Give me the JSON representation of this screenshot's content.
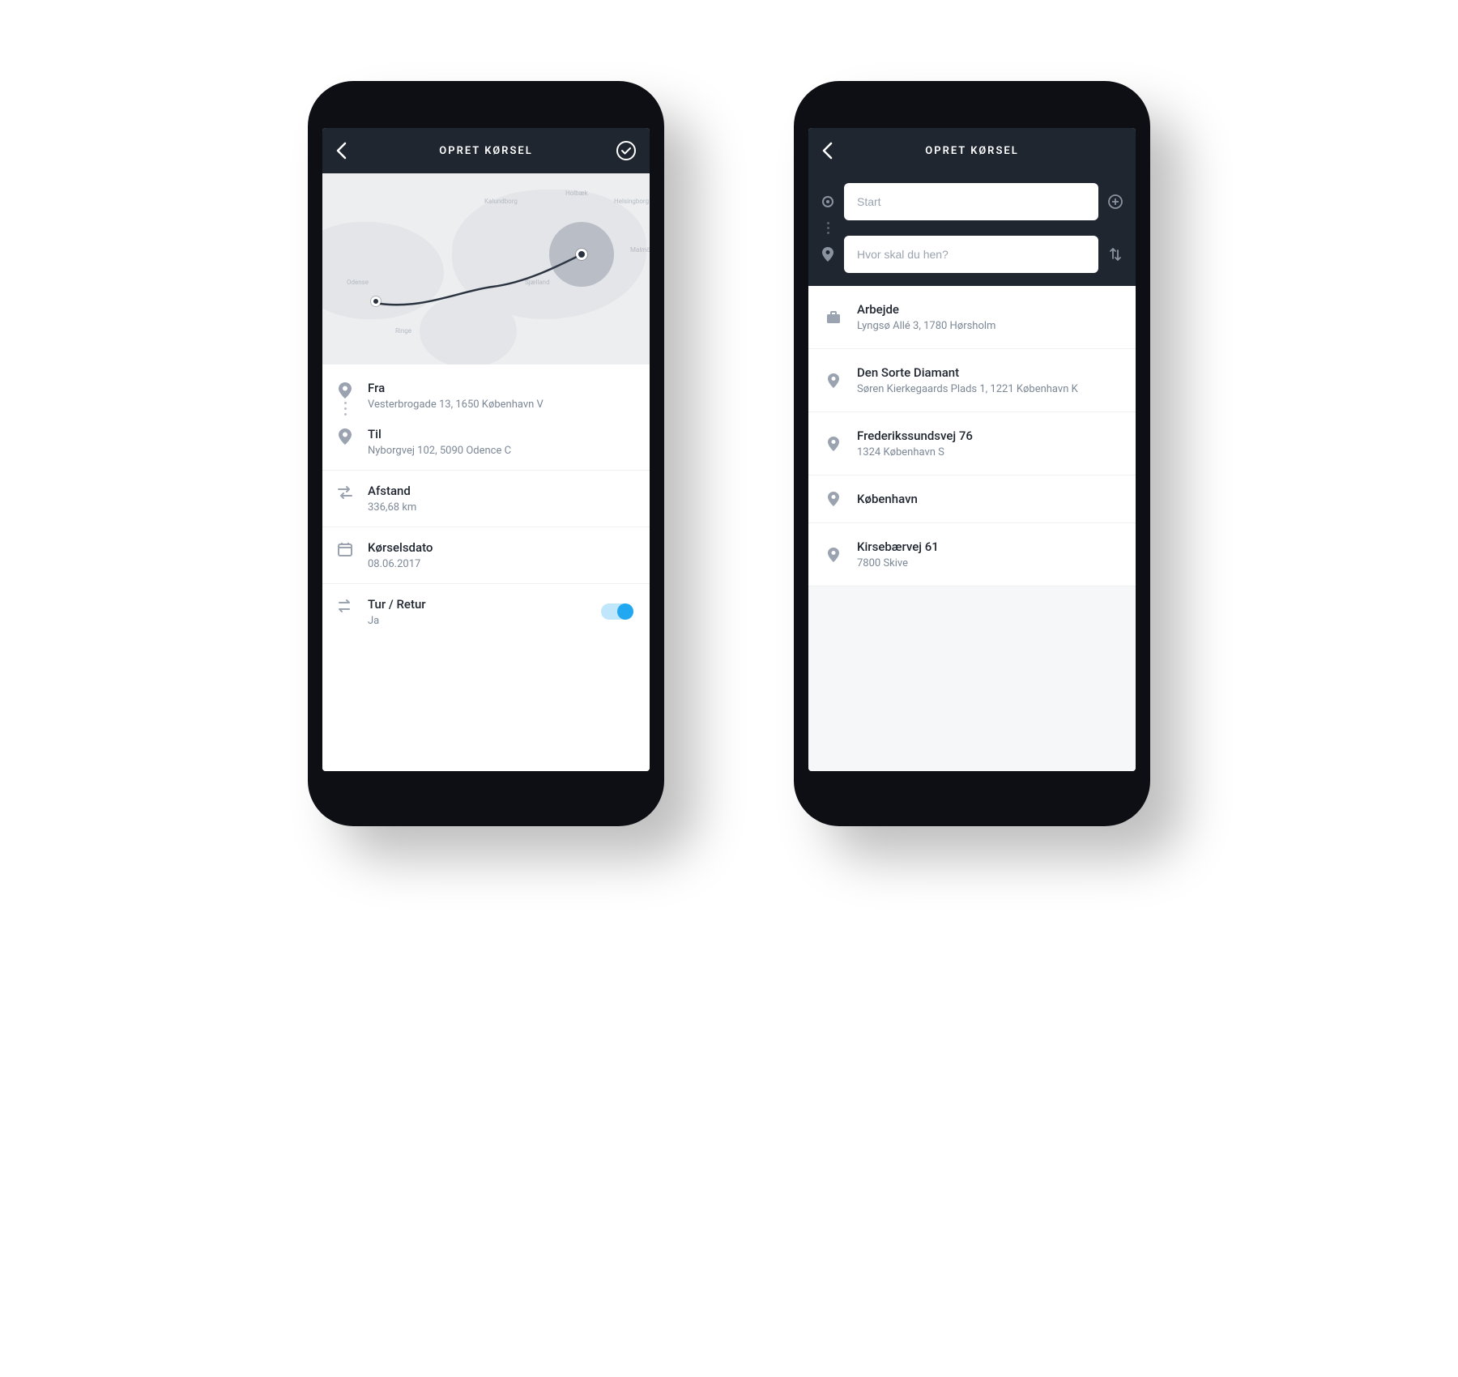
{
  "phone1": {
    "header": {
      "title": "OPRET KØRSEL"
    },
    "from": {
      "label": "Fra",
      "address": "Vesterbrogade 13, 1650 København V"
    },
    "to": {
      "label": "Til",
      "address": "Nyborgvej 102, 5090 Odence C"
    },
    "distance": {
      "label": "Afstand",
      "value": "336,68 km"
    },
    "date": {
      "label": "Kørselsdato",
      "value": "08.06.2017"
    },
    "roundtrip": {
      "label": "Tur / Retur",
      "value": "Ja",
      "on": true
    }
  },
  "phone2": {
    "header": {
      "title": "OPRET KØRSEL"
    },
    "inputs": {
      "start_placeholder": "Start",
      "dest_placeholder": "Hvor skal du hen?"
    },
    "suggestions": [
      {
        "icon": "briefcase",
        "title": "Arbejde",
        "subtitle": "Lyngsø Allé 3, 1780 Hørsholm"
      },
      {
        "icon": "pin",
        "title": "Den Sorte Diamant",
        "subtitle": "Søren Kierkegaards Plads 1, 1221 København K"
      },
      {
        "icon": "pin",
        "title": "Frederikssundsvej 76",
        "subtitle": "1324 København S"
      },
      {
        "icon": "pin",
        "title": "København",
        "subtitle": ""
      },
      {
        "icon": "pin",
        "title": "Kirsebærvej 61",
        "subtitle": "7800 Skive"
      }
    ]
  }
}
